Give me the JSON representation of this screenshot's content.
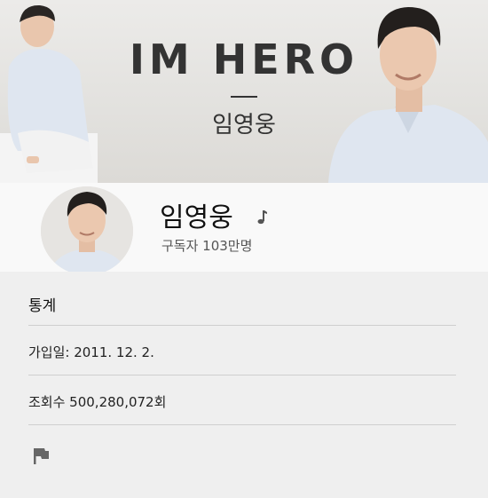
{
  "banner": {
    "title": "IM HERO",
    "subtitle": "임영웅"
  },
  "channel": {
    "name": "임영웅",
    "subscribers": "구독자 103만명",
    "badge_icon": "music-note-icon"
  },
  "about": {
    "heading": "통계",
    "joined": "가입일: 2011. 12. 2.",
    "views": "조회수 500,280,072회",
    "report_icon": "flag-icon"
  },
  "colors": {
    "background": "#efefef",
    "profile_bg": "#f9f9f9",
    "shirt": "#dfe6f0"
  }
}
